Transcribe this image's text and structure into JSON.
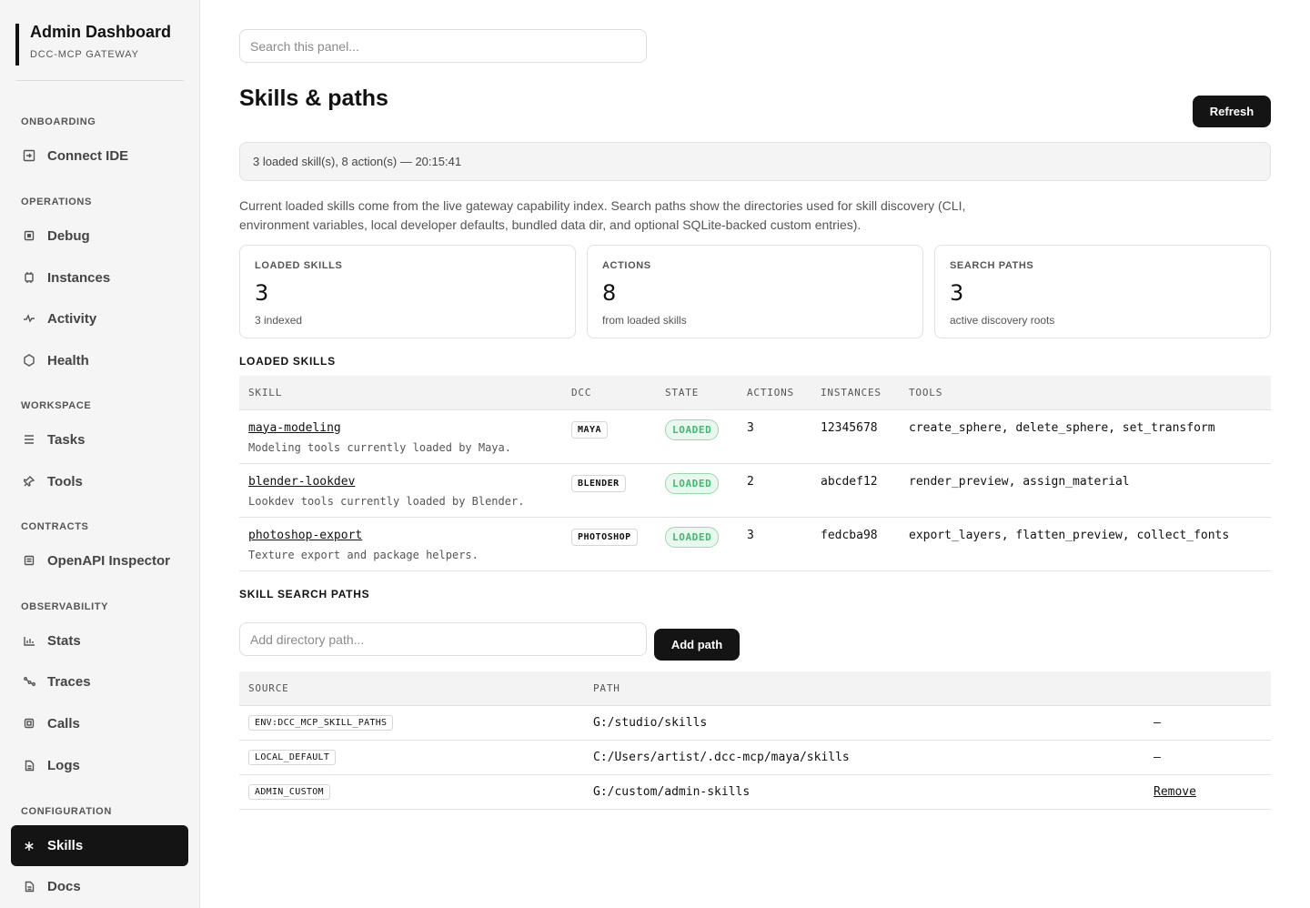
{
  "brand": {
    "title": "Admin Dashboard",
    "subtitle": "DCC-MCP GATEWAY"
  },
  "sidebar": {
    "sections": [
      {
        "label": "ONBOARDING",
        "items": [
          {
            "label": "Connect IDE",
            "icon": "login-icon"
          }
        ]
      },
      {
        "label": "OPERATIONS",
        "items": [
          {
            "label": "Debug",
            "icon": "debug-icon"
          },
          {
            "label": "Instances",
            "icon": "instances-icon"
          },
          {
            "label": "Activity",
            "icon": "activity-icon"
          },
          {
            "label": "Health",
            "icon": "health-icon"
          }
        ]
      },
      {
        "label": "WORKSPACE",
        "items": [
          {
            "label": "Tasks",
            "icon": "list-icon"
          },
          {
            "label": "Tools",
            "icon": "pin-icon"
          }
        ]
      },
      {
        "label": "CONTRACTS",
        "items": [
          {
            "label": "OpenAPI Inspector",
            "icon": "document-icon"
          }
        ]
      },
      {
        "label": "OBSERVABILITY",
        "items": [
          {
            "label": "Stats",
            "icon": "bar-chart-icon"
          },
          {
            "label": "Traces",
            "icon": "traces-icon"
          },
          {
            "label": "Calls",
            "icon": "calls-icon"
          },
          {
            "label": "Logs",
            "icon": "file-icon"
          }
        ]
      },
      {
        "label": "CONFIGURATION",
        "items": [
          {
            "label": "Skills",
            "icon": "asterisk-icon",
            "active": true
          },
          {
            "label": "Docs",
            "icon": "file-icon"
          }
        ]
      }
    ]
  },
  "search": {
    "placeholder": "Search this panel..."
  },
  "page": {
    "title": "Skills & paths",
    "refresh_label": "Refresh",
    "status": "3 loaded skill(s), 8 action(s) — 20:15:41",
    "description": "Current loaded skills come from the live gateway capability index. Search paths show the directories used for skill discovery (CLI, environment variables, local developer defaults, bundled data dir, and optional SQLite-backed custom entries)."
  },
  "cards": [
    {
      "label": "LOADED SKILLS",
      "value": "3",
      "sub": "3 indexed"
    },
    {
      "label": "ACTIONS",
      "value": "8",
      "sub": "from loaded skills"
    },
    {
      "label": "SEARCH PATHS",
      "value": "3",
      "sub": "active discovery roots"
    }
  ],
  "skills": {
    "heading": "LOADED SKILLS",
    "columns": [
      "SKILL",
      "DCC",
      "STATE",
      "ACTIONS",
      "INSTANCES",
      "TOOLS"
    ],
    "rows": [
      {
        "name": "maya-modeling",
        "desc": "Modeling tools currently loaded by Maya.",
        "dcc": "MAYA",
        "state": "LOADED",
        "actions": "3",
        "instances": "12345678",
        "tools": "create_sphere, delete_sphere, set_transform"
      },
      {
        "name": "blender-lookdev",
        "desc": "Lookdev tools currently loaded by Blender.",
        "dcc": "BLENDER",
        "state": "LOADED",
        "actions": "2",
        "instances": "abcdef12",
        "tools": "render_preview, assign_material"
      },
      {
        "name": "photoshop-export",
        "desc": "Texture export and package helpers.",
        "dcc": "PHOTOSHOP",
        "state": "LOADED",
        "actions": "3",
        "instances": "fedcba98",
        "tools": "export_layers, flatten_preview, collect_fonts"
      }
    ]
  },
  "paths": {
    "heading": "SKILL SEARCH PATHS",
    "input_placeholder": "Add directory path...",
    "add_label": "Add path",
    "columns": [
      "SOURCE",
      "PATH",
      ""
    ],
    "rows": [
      {
        "source": "ENV:DCC_MCP_SKILL_PATHS",
        "path": "G:/studio/skills",
        "action": "—",
        "removable": false
      },
      {
        "source": "LOCAL_DEFAULT",
        "path": "C:/Users/artist/.dcc-mcp/maya/skills",
        "action": "—",
        "removable": false
      },
      {
        "source": "ADMIN_CUSTOM",
        "path": "G:/custom/admin-skills",
        "action": "Remove",
        "removable": true
      }
    ]
  },
  "colors": {
    "accent": "#141414",
    "loaded_text": "#42b870",
    "loaded_bg": "#e9f8ef",
    "sidebar_bg": "#f5f5f5"
  }
}
